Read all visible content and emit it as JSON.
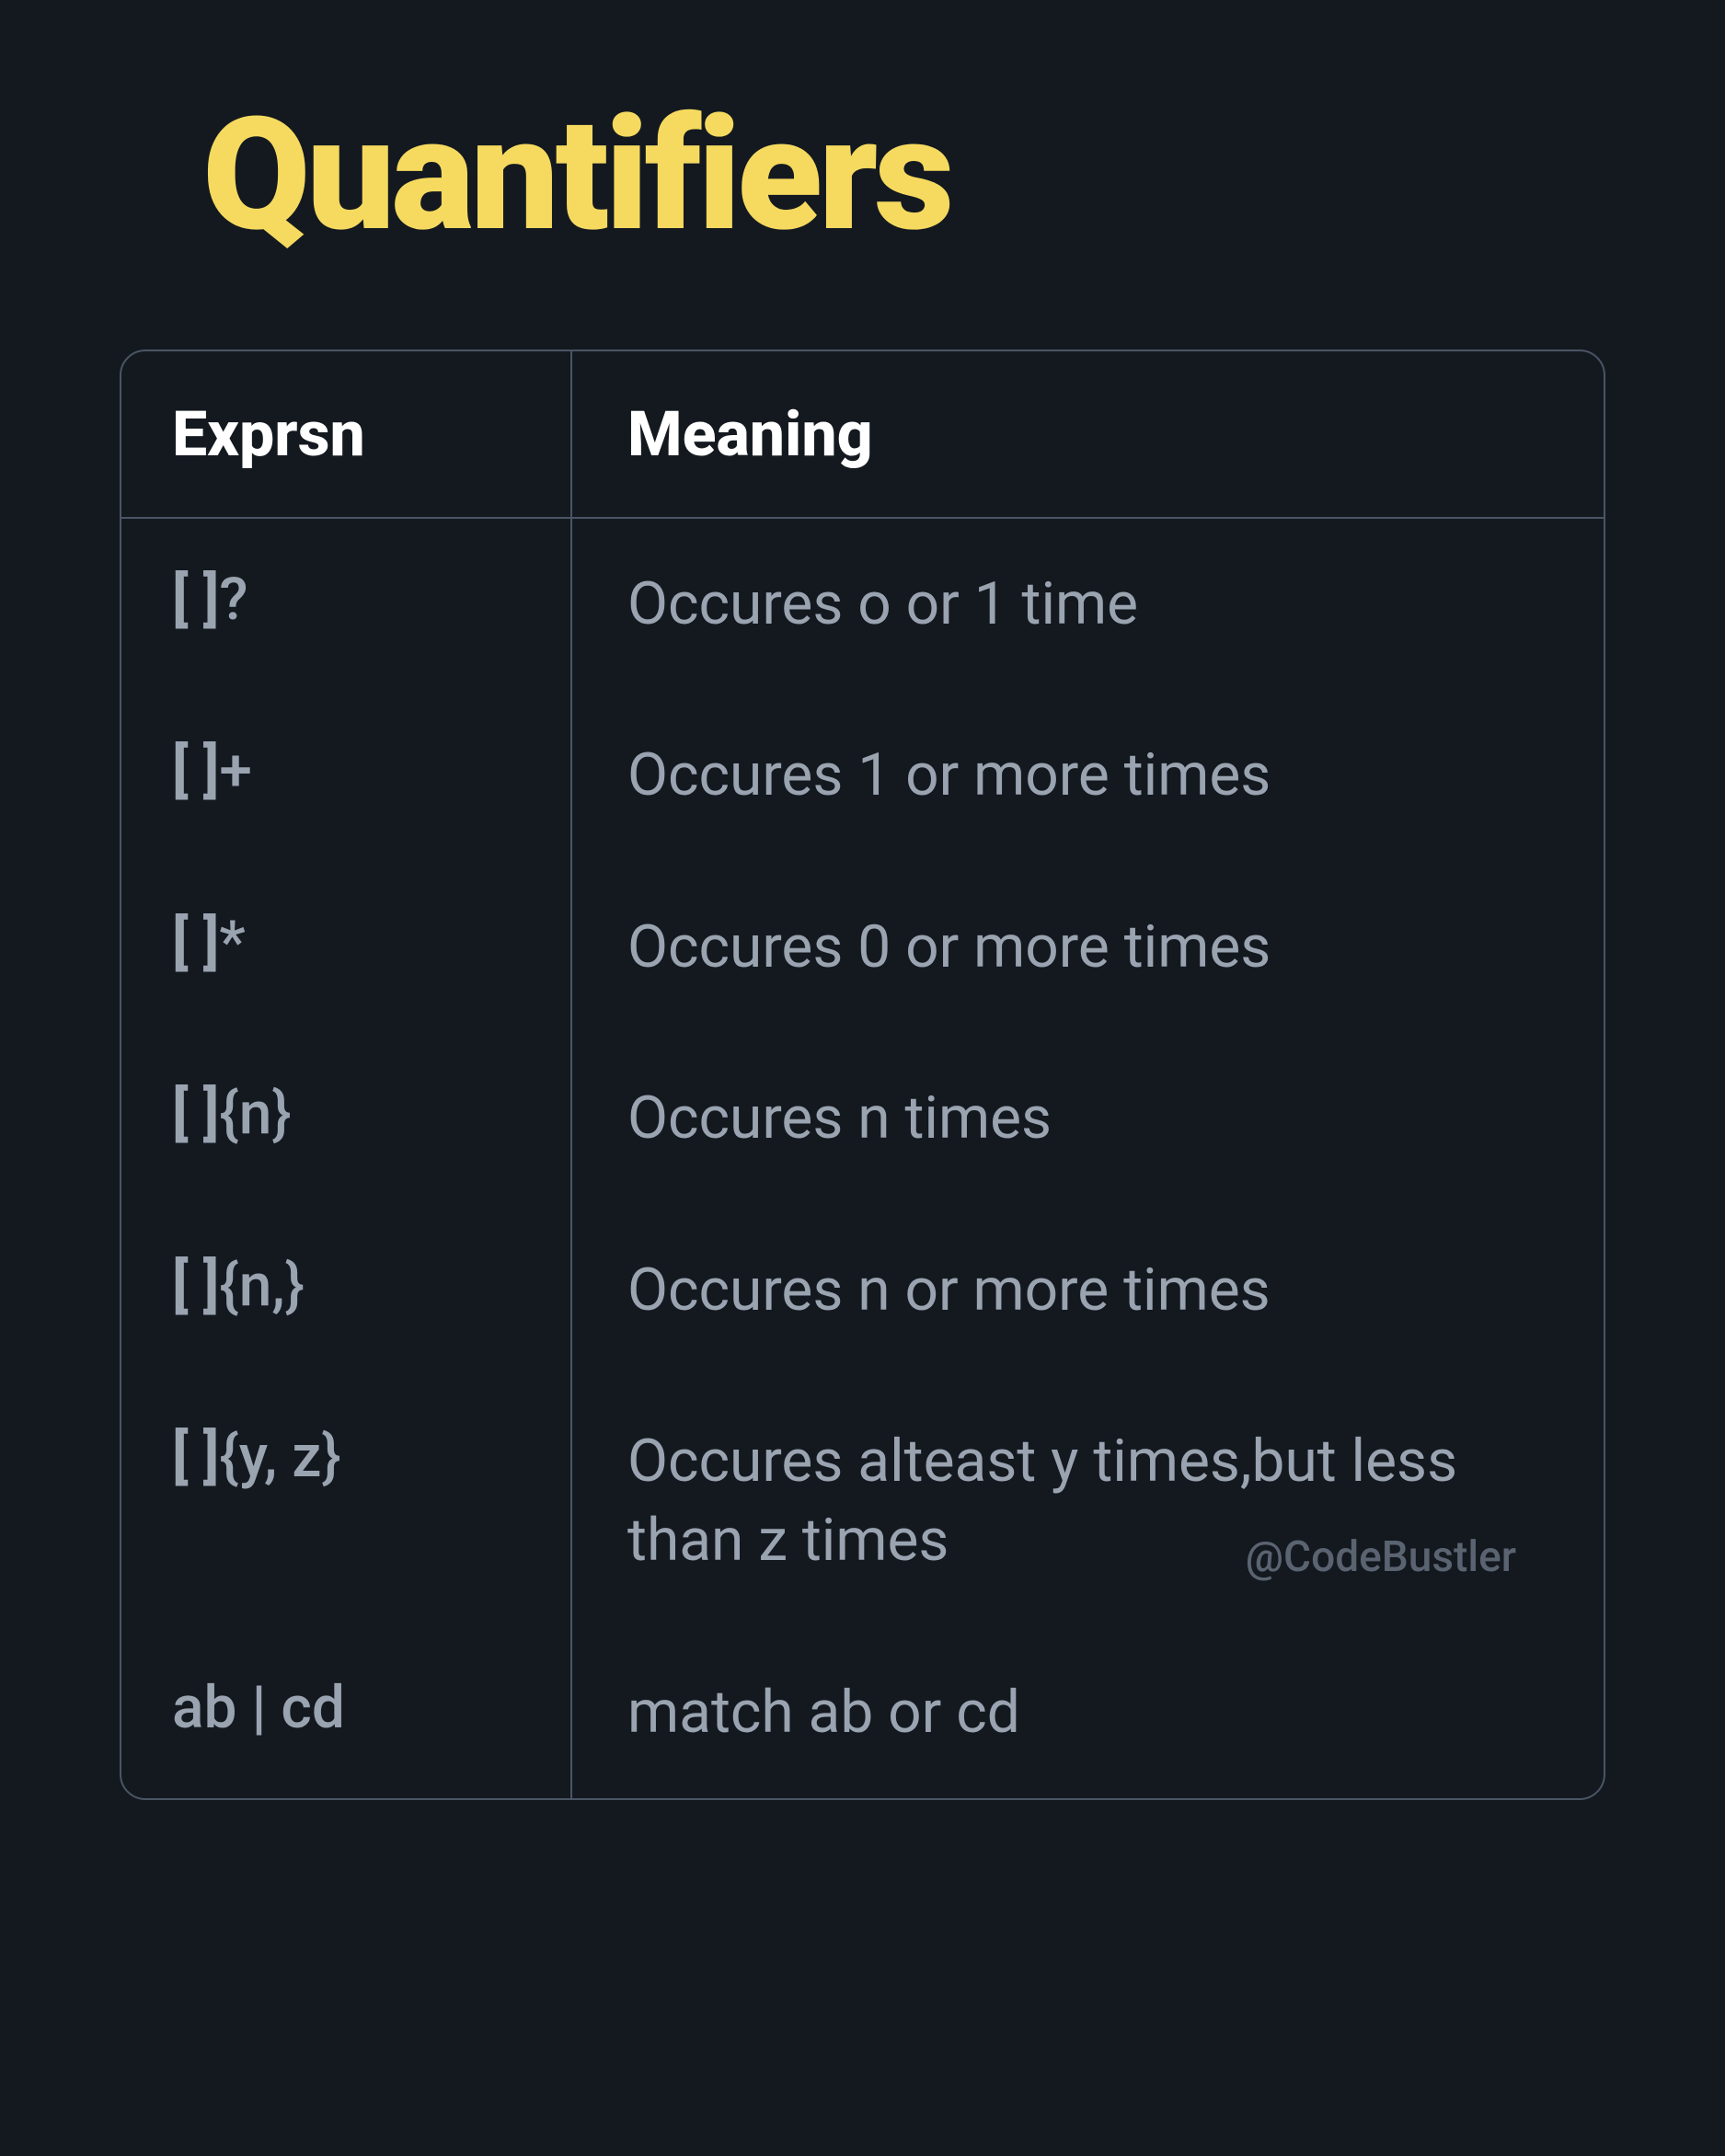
{
  "title": "Quantifiers",
  "columns": {
    "left": "Exprsn",
    "right": "Meaning"
  },
  "rows": [
    {
      "expr": "[  ]?",
      "meaning": "Occures o or 1 time"
    },
    {
      "expr": "[  ]+",
      "meaning": "Occures 1 or more times"
    },
    {
      "expr": "[  ]*",
      "meaning": "Occures 0 or more times"
    },
    {
      "expr": "[  ]{n}",
      "meaning": "Occures n times"
    },
    {
      "expr": "[  ]{n,}",
      "meaning": "Occures n or more times"
    },
    {
      "expr": "[  ]{y, z}",
      "meaning": "Occures alteast y times,but less than z times"
    },
    {
      "expr": "ab | cd",
      "meaning": "match ab or cd"
    }
  ],
  "watermark": "@CodeBustler",
  "watermark_row_index": 5
}
